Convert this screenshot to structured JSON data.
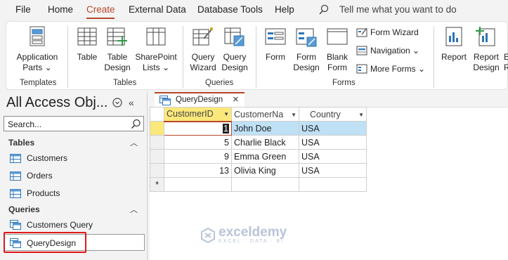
{
  "menu": {
    "items": [
      "File",
      "Home",
      "Create",
      "External Data",
      "Database Tools",
      "Help"
    ],
    "active": "Create",
    "tell_me": "Tell me what you want to do"
  },
  "ribbon": {
    "templates": {
      "app_parts_line1": "Application",
      "app_parts_line2": "Parts ⌄",
      "label": "Templates"
    },
    "tables": {
      "table": "Table",
      "table_design1": "Table",
      "table_design2": "Design",
      "sharepoint1": "SharePoint",
      "sharepoint2": "Lists ⌄",
      "label": "Tables"
    },
    "queries": {
      "wizard1": "Query",
      "wizard2": "Wizard",
      "design1": "Query",
      "design2": "Design",
      "label": "Queries"
    },
    "forms": {
      "form": "Form",
      "form_design1": "Form",
      "form_design2": "Design",
      "blank1": "Blank",
      "blank2": "Form",
      "form_wizard": "Form Wizard",
      "navigation": "Navigation ⌄",
      "more_forms": "More Forms ⌄",
      "label": "Forms"
    },
    "reports": {
      "report": "Report",
      "report_design1": "Report",
      "report_design2": "Design",
      "partial1": "E",
      "partial2": "R"
    }
  },
  "nav": {
    "title": "All Access Obj...",
    "search_placeholder": "Search...",
    "tables_header": "Tables",
    "tables": [
      "Customers",
      "Orders",
      "Products"
    ],
    "queries_header": "Queries",
    "queries": [
      "Customers Query",
      "QueryDesign"
    ]
  },
  "tab": {
    "label": "QueryDesign"
  },
  "grid": {
    "columns": [
      "CustomerID",
      "CustomerNa",
      "Country"
    ],
    "rows": [
      {
        "id": "1",
        "name": "John Doe",
        "country": "USA"
      },
      {
        "id": "5",
        "name": "Charlie Black",
        "country": "USA"
      },
      {
        "id": "9",
        "name": "Emma Green",
        "country": "USA"
      },
      {
        "id": "13",
        "name": "Olivia King",
        "country": "USA"
      }
    ],
    "new_row_marker": "*"
  },
  "watermark": {
    "name": "exceldemy",
    "tagline": "EXCEL · DATA · BI"
  },
  "colors": {
    "accent": "#b7472a",
    "selected_row": "#bfe0f5",
    "header_highlight": "#fbe87a",
    "callout": "#e01818"
  }
}
